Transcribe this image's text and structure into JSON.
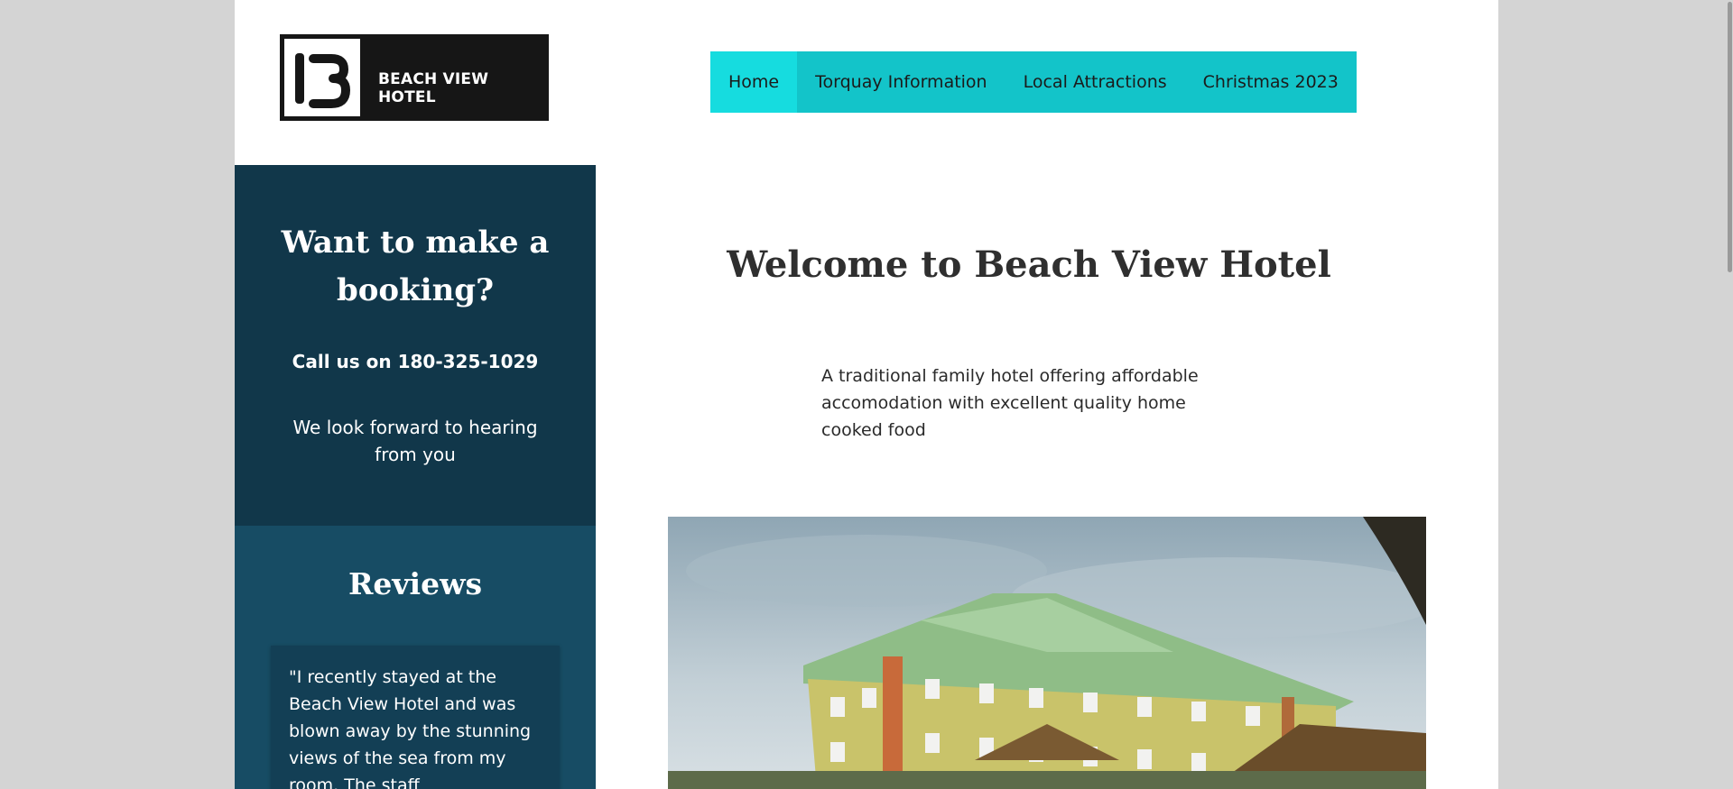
{
  "header": {
    "logo_text": "BEACH VIEW HOTEL",
    "logo_mark": "B"
  },
  "nav": {
    "items": [
      {
        "label": "Home",
        "active": true
      },
      {
        "label": "Torquay Information",
        "active": false
      },
      {
        "label": "Local Attractions",
        "active": false
      },
      {
        "label": "Christmas 2023",
        "active": false
      }
    ]
  },
  "sidebar": {
    "booking_title": "Want to make a booking?",
    "call_text": "Call us on 180-325-1029",
    "hear_text": "We look forward to hearing from you",
    "reviews_title": "Reviews",
    "review_text": "\"I recently stayed at the Beach View Hotel and was blown away by the stunning views of the sea from my room. The staff"
  },
  "main": {
    "title": "Welcome to Beach View Hotel",
    "tagline": "A traditional family hotel offering affordable accomodation with excellent quality home cooked food",
    "hero_image": "hotel-building-photo"
  },
  "colors": {
    "nav_bg": "#13c4c9",
    "nav_active": "#16dcdf",
    "booking_bg": "#11374a",
    "reviews_bg": "#174c64",
    "page_bg": "#d4d4d4"
  }
}
